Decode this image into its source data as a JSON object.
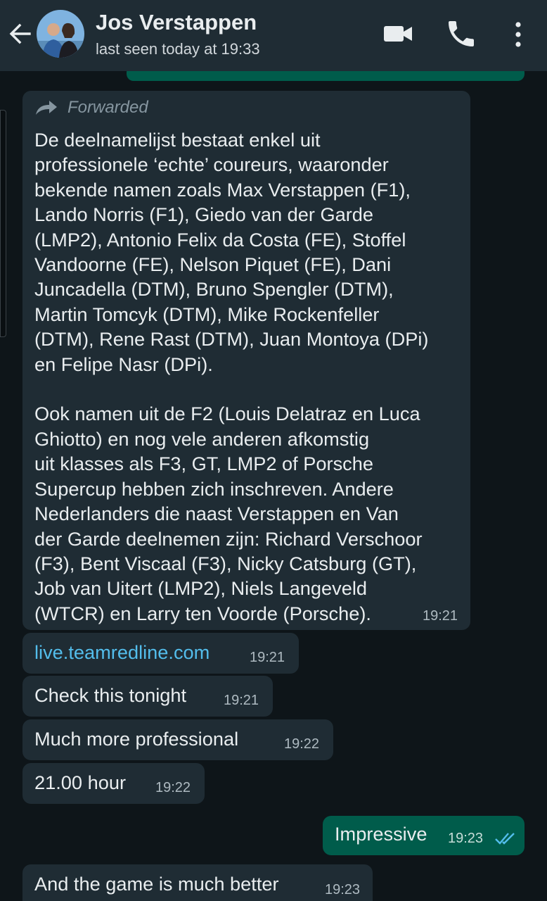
{
  "header": {
    "contact_name": "Jos Verstappen",
    "last_seen": "last seen today at 19:33",
    "icons": [
      "back-arrow-icon",
      "avatar",
      "video-call-icon",
      "phone-icon",
      "more-vert-icon"
    ]
  },
  "messages": [
    {
      "direction": "in",
      "forwarded_label": "Forwarded",
      "text": "De deelnamelijst bestaat enkel uit\nprofessionele ‘echte’ coureurs, waaronder\nbekende namen zoals Max Verstappen (F1),\nLando Norris (F1), Giedo van der Garde\n(LMP2), Antonio Felix da Costa (FE), Stoffel\nVandoorne (FE), Nelson Piquet (FE), Dani\nJuncadella (DTM), Bruno Spengler (DTM),\nMartin Tomcyk (DTM), Mike Rockenfeller\n(DTM), Rene Rast (DTM), Juan Montoya (DPi)\nen Felipe Nasr (DPi).\n\nOok namen uit de F2 (Louis Delatraz en Luca\nGhiotto) en nog vele anderen afkomstig\nuit klasses als F3, GT, LMP2 of Porsche\nSupercup hebben zich inschreven. Andere\nNederlanders die naast Verstappen en Van\nder Garde deelnemen zijn: Richard Verschoor\n(F3), Bent Viscaal (F3), Nicky Catsburg (GT),\nJob van Uitert (LMP2), Niels Langeveld\n(WTCR) en Larry ten Voorde (Porsche).",
      "time": "19:21"
    },
    {
      "direction": "in",
      "text": "live.teamredline.com",
      "time": "19:21",
      "is_link": true
    },
    {
      "direction": "in",
      "text": "Check this tonight",
      "time": "19:21"
    },
    {
      "direction": "in",
      "text": "Much more professional",
      "time": "19:22"
    },
    {
      "direction": "in",
      "text": "21.00 hour",
      "time": "19:22"
    },
    {
      "direction": "out",
      "text": "Impressive",
      "time": "19:23",
      "status": "read",
      "tick_color": "#53bdeb"
    },
    {
      "direction": "in",
      "text": "And the game is much better",
      "time": "19:23"
    }
  ],
  "colors": {
    "header_bg": "#1f2c34",
    "chat_bg": "#0e1519",
    "incoming_bubble": "#1f2c34",
    "outgoing_bubble": "#005c4b",
    "link": "#53bdeb"
  }
}
